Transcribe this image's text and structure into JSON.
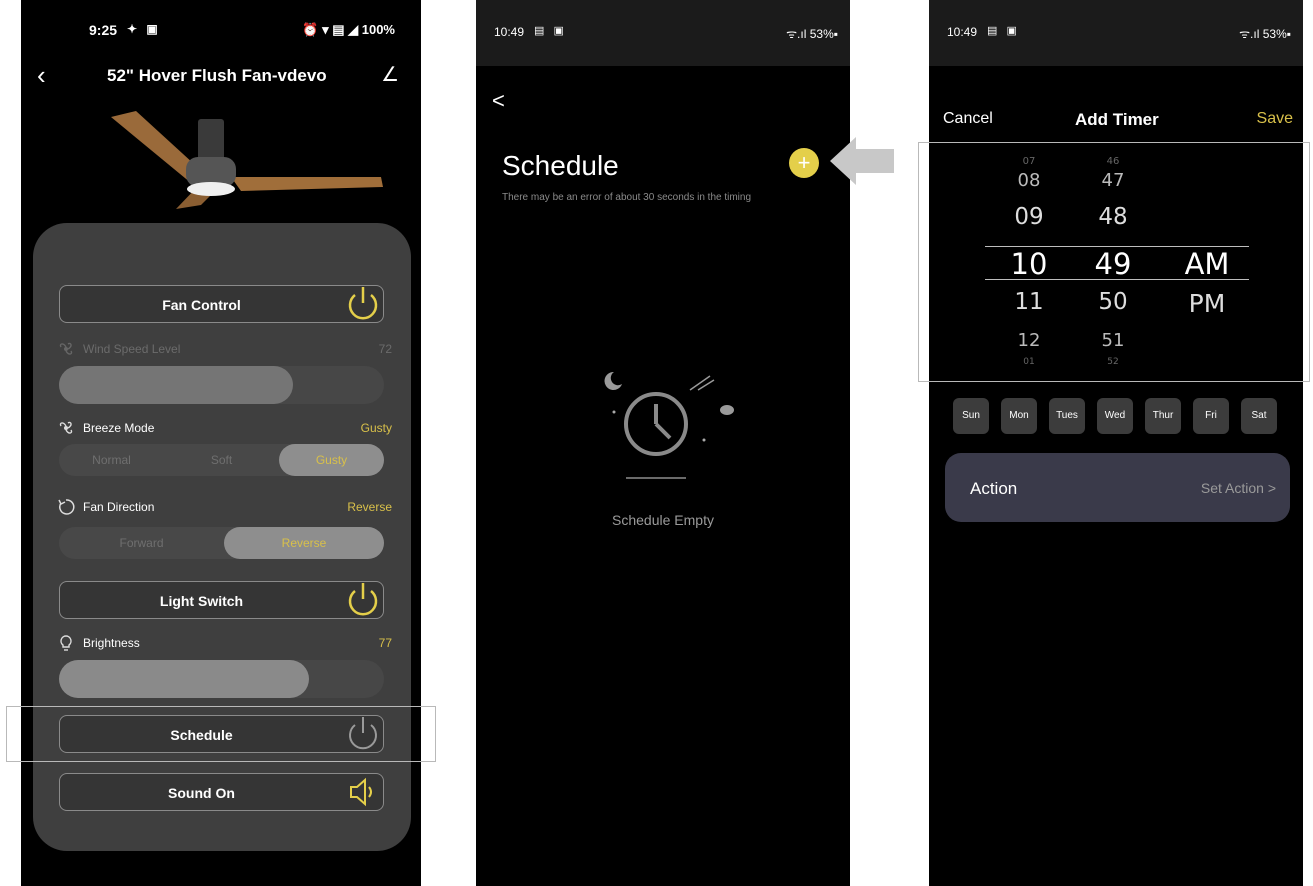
{
  "screen1": {
    "status": {
      "time": "9:25",
      "icons": "✦ ▣",
      "right": "⏰ ▾ ▤ ◢ 100%"
    },
    "title": "52\" Hover Flush Fan-vdevo",
    "fan_control": {
      "label": "Fan Control"
    },
    "wind_speed": {
      "label": "Wind Speed Level",
      "value": "72",
      "level_percent": 72
    },
    "breeze_mode": {
      "label": "Breeze Mode",
      "value": "Gusty",
      "options": [
        "Normal",
        "Soft",
        "Gusty"
      ],
      "selected": "Gusty"
    },
    "fan_direction": {
      "label": "Fan Direction",
      "value": "Reverse",
      "options": [
        "Forward",
        "Reverse"
      ],
      "selected": "Reverse"
    },
    "light_switch": {
      "label": "Light Switch"
    },
    "brightness": {
      "label": "Brightness",
      "value": "77",
      "level_percent": 77
    },
    "schedule": {
      "label": "Schedule"
    },
    "sound": {
      "label": "Sound On"
    },
    "accent_color": "#d8c04a"
  },
  "screen2": {
    "status": {
      "time": "10:49",
      "icons": "▤ ▣",
      "right": "ᯤ.ıl 53%▪"
    },
    "back": "<",
    "title": "Schedule",
    "subtitle": "There may be an error of about 30 seconds in the timing",
    "add": "+",
    "empty": "Schedule Empty",
    "add_button_color": "#e4cf4a"
  },
  "screen3": {
    "status": {
      "time": "10:49",
      "icons": "▤ ▣",
      "right": "ᯤ.ıl 53%▪"
    },
    "cancel": "Cancel",
    "title": "Add Timer",
    "save": "Save",
    "hours": [
      "07",
      "08",
      "09",
      "10",
      "11",
      "12",
      "01"
    ],
    "minutes": [
      "46",
      "47",
      "48",
      "49",
      "50",
      "51",
      "52"
    ],
    "ampm": [
      "AM",
      "PM"
    ],
    "days": [
      "Sun",
      "Mon",
      "Tues",
      "Wed",
      "Thur",
      "Fri",
      "Sat"
    ],
    "action": {
      "label": "Action",
      "value": "Set Action >"
    }
  }
}
